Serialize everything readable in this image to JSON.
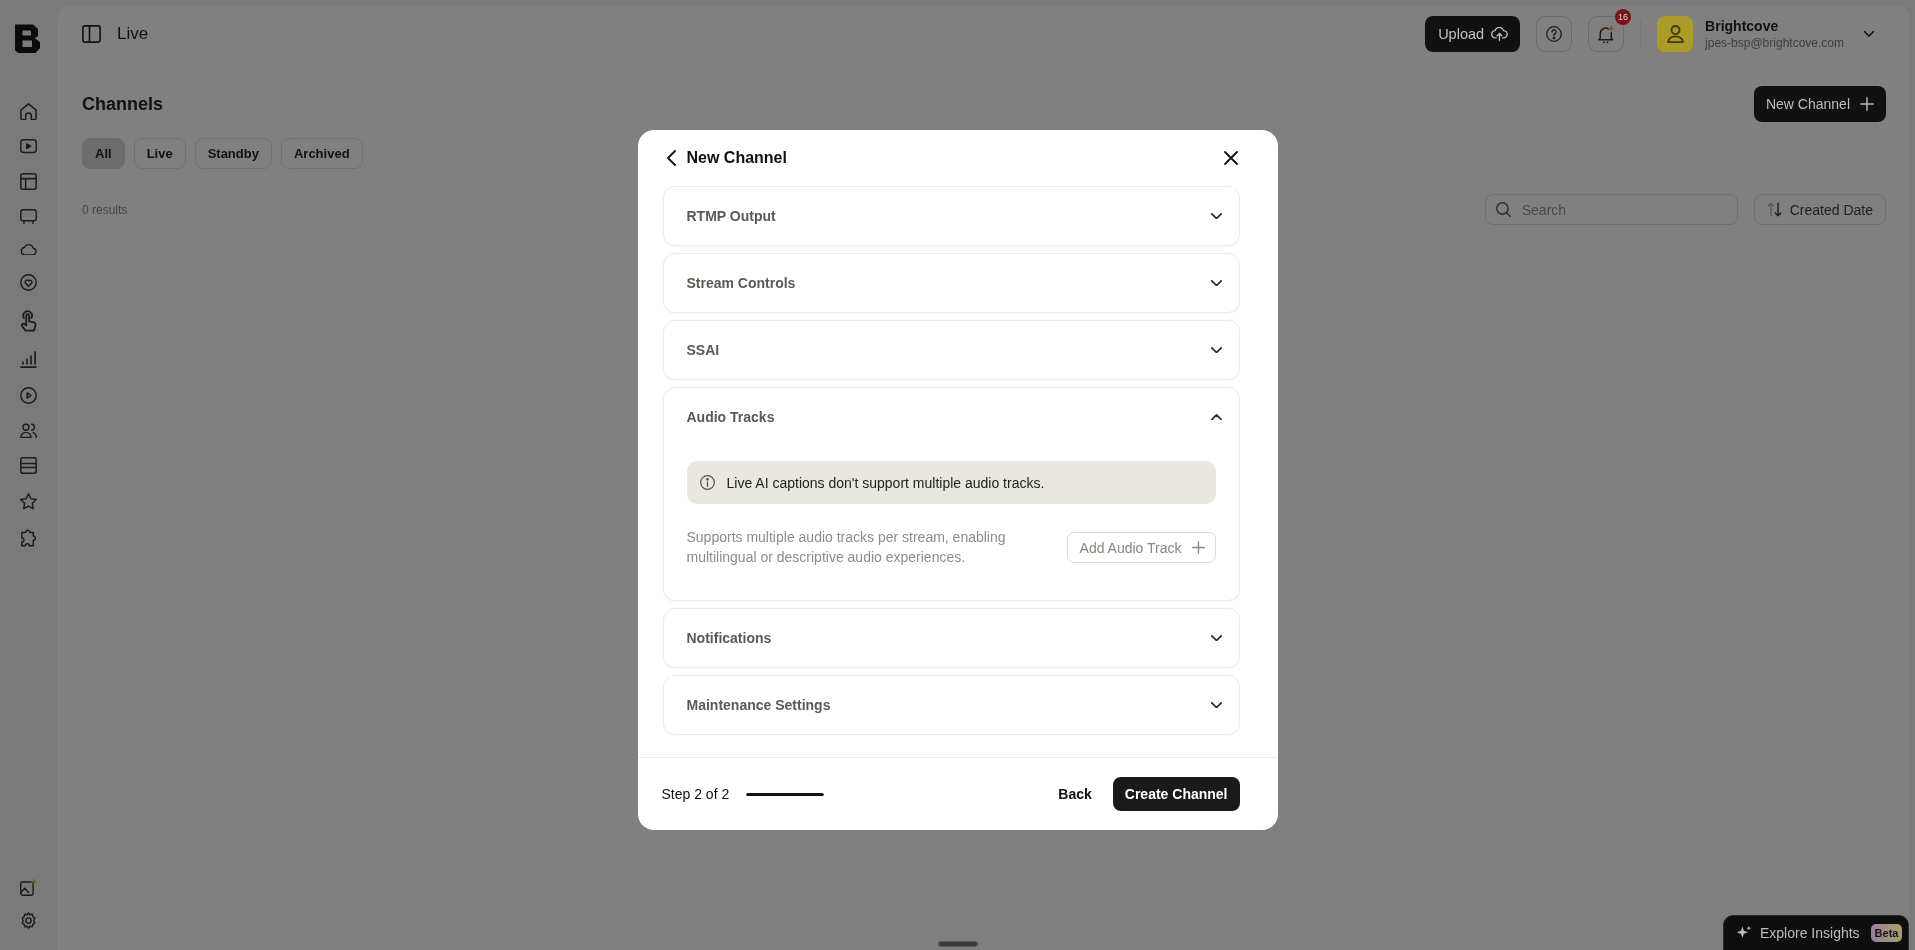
{
  "header": {
    "title": "Live",
    "upload_button": "Upload",
    "notification_count": "16",
    "account": {
      "name": "Brightcove",
      "email": "jpes-bsp@brightcove.com"
    }
  },
  "page": {
    "title": "Channels",
    "new_button": "New Channel",
    "filters": [
      {
        "label": "All",
        "selected": true
      },
      {
        "label": "Live",
        "selected": false
      },
      {
        "label": "Standby",
        "selected": false
      },
      {
        "label": "Archived",
        "selected": false
      }
    ],
    "result_count": "0 results",
    "search": {
      "placeholder": "Search"
    },
    "sort_button": "Created Date"
  },
  "modal": {
    "title": "New Channel",
    "sections": [
      {
        "title": "RTMP Output",
        "expanded": false
      },
      {
        "title": "Stream Controls",
        "expanded": false
      },
      {
        "title": "SSAI",
        "expanded": false
      },
      {
        "title": "Audio Tracks",
        "expanded": true,
        "notice": "Live AI captions don't support multiple audio tracks.",
        "description": "Supports multiple audio tracks per stream, enabling multilingual or descriptive audio experiences.",
        "button": "Add Audio Track"
      },
      {
        "title": "Notifications",
        "expanded": false
      },
      {
        "title": "Maintenance Settings",
        "expanded": false
      }
    ],
    "footer": {
      "step": "Step 2 of 2",
      "level": 1,
      "back_button": "Back",
      "primary_button": "Create Channel"
    }
  },
  "insights_button": {
    "label": "Explore Insights",
    "badge": "Beta"
  }
}
